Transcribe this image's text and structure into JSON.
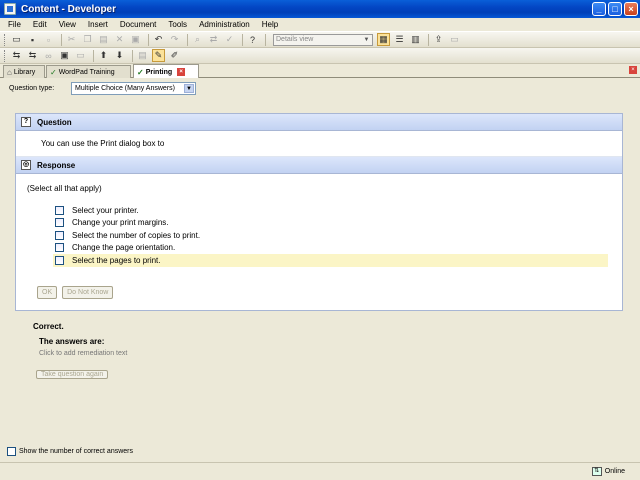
{
  "window": {
    "title": "Content - Developer"
  },
  "menu": [
    {
      "label": "File"
    },
    {
      "label": "Edit"
    },
    {
      "label": "View"
    },
    {
      "label": "Insert"
    },
    {
      "label": "Document"
    },
    {
      "label": "Tools"
    },
    {
      "label": "Administration"
    },
    {
      "label": "Help"
    }
  ],
  "toolbar": {
    "view_select": "Details view"
  },
  "tabs": [
    {
      "label": "Library"
    },
    {
      "label": "WordPad Training"
    },
    {
      "label": "Printing"
    }
  ],
  "question_type": {
    "label": "Question type:",
    "value": "Multiple Choice (Many Answers)"
  },
  "question": {
    "header": "Question",
    "text": "You can use the Print dialog box to"
  },
  "response": {
    "header": "Response",
    "instruction": "(Select all that apply)",
    "options": [
      {
        "label": "Select your printer.",
        "checked": false
      },
      {
        "label": "Change your print margins.",
        "checked": false
      },
      {
        "label": "Select the number of copies to print.",
        "checked": false
      },
      {
        "label": "Change the page orientation.",
        "checked": false
      },
      {
        "label": "Select the pages to print.",
        "checked": false
      }
    ],
    "ok_label": "OK",
    "dont_know_label": "Do Not Know"
  },
  "feedback": {
    "result": "Correct.",
    "answers_title": "The answers are:",
    "remediation_placeholder": "Click to add remediation text",
    "retake_label": "Take question again"
  },
  "show_correct_count": {
    "label": "Show the number of correct answers",
    "checked": false
  },
  "status": {
    "online": "Online"
  }
}
